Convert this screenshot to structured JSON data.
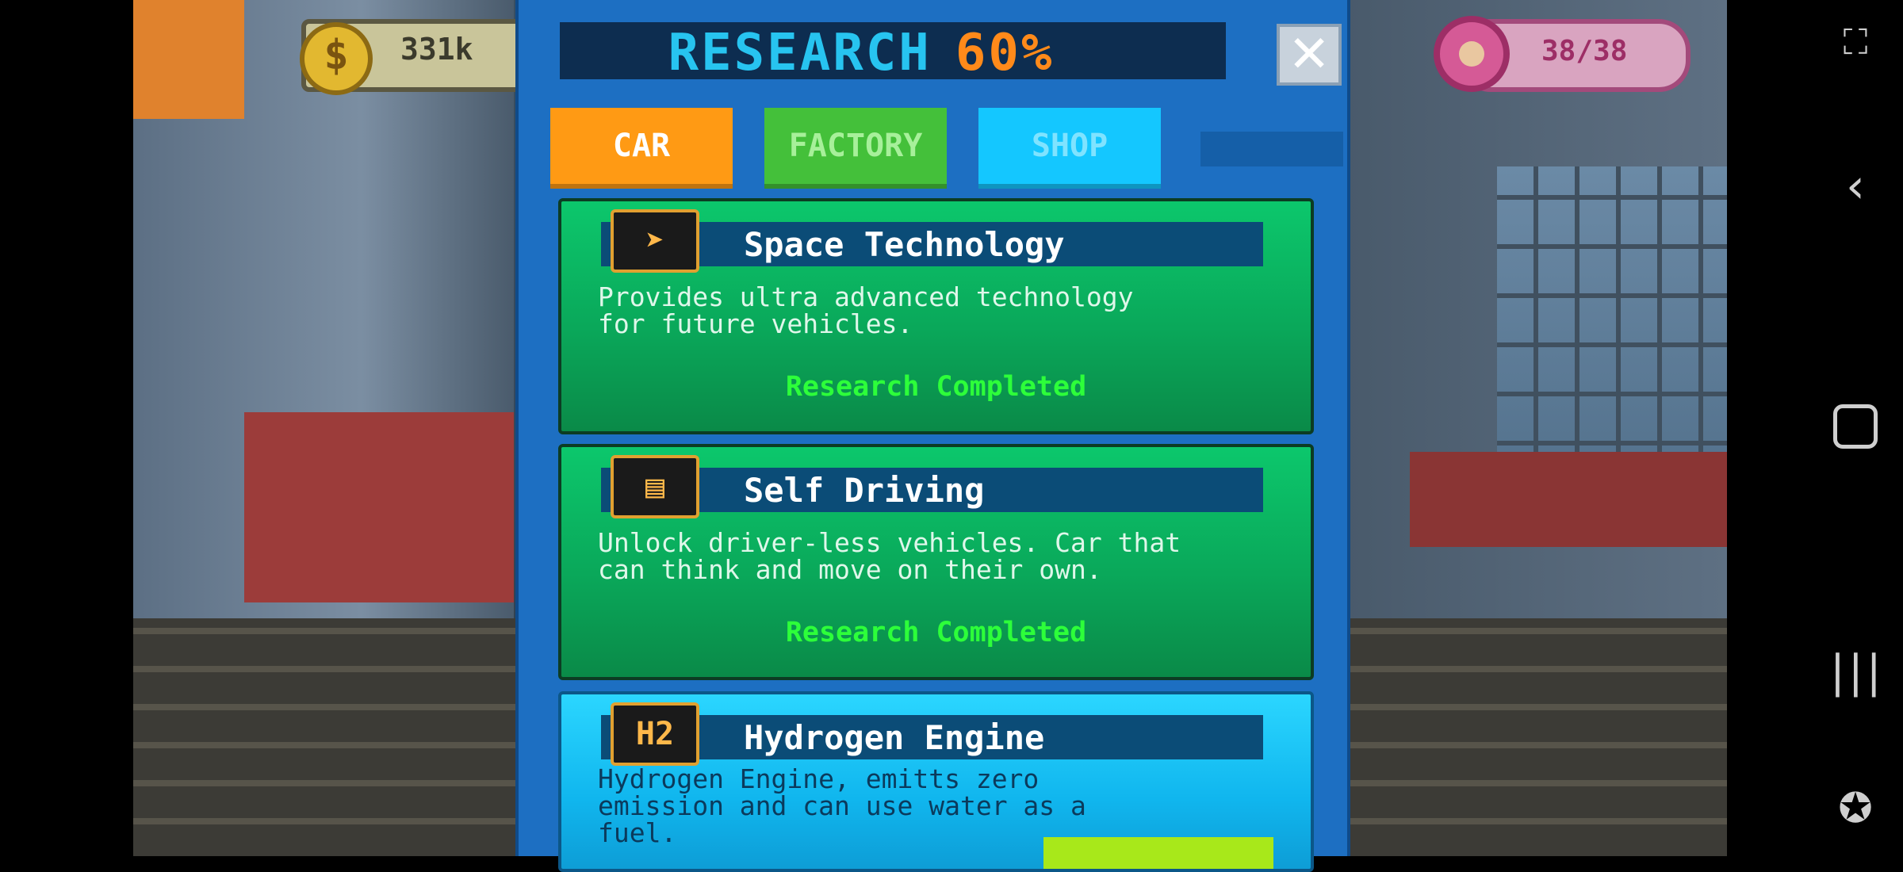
{
  "hud": {
    "money": "331k",
    "coin_symbol": "$",
    "donuts": "38/38"
  },
  "panel": {
    "title": "RESEARCH",
    "progress": "60%",
    "close_symbol": "✕",
    "tabs": [
      {
        "label": "CAR",
        "active": true,
        "color": "#ff9a14"
      },
      {
        "label": "FACTORY",
        "active": false,
        "color": "#44c03a"
      },
      {
        "label": "SHOP",
        "active": false,
        "color": "#14c7ff"
      }
    ],
    "items": [
      {
        "icon": "rocket-icon",
        "title": "Space Technology",
        "description": "Provides ultra advanced technology\nfor future vehicles.",
        "status": "Research Completed"
      },
      {
        "icon": "computer-icon",
        "title": "Self Driving",
        "description": "Unlock driver-less vehicles. Car that\ncan think and move on their own.",
        "status": "Research Completed"
      },
      {
        "icon": "h2-icon",
        "icon_text": "H2",
        "title": "Hydrogen Engine",
        "description": "Hydrogen Engine, emitts zero\nemission and can use water as a\nfuel.",
        "status": ""
      }
    ]
  },
  "system_nav": [
    "screen-control-icon",
    "back-icon",
    "home-icon",
    "recents-icon",
    "game-launcher-icon"
  ]
}
